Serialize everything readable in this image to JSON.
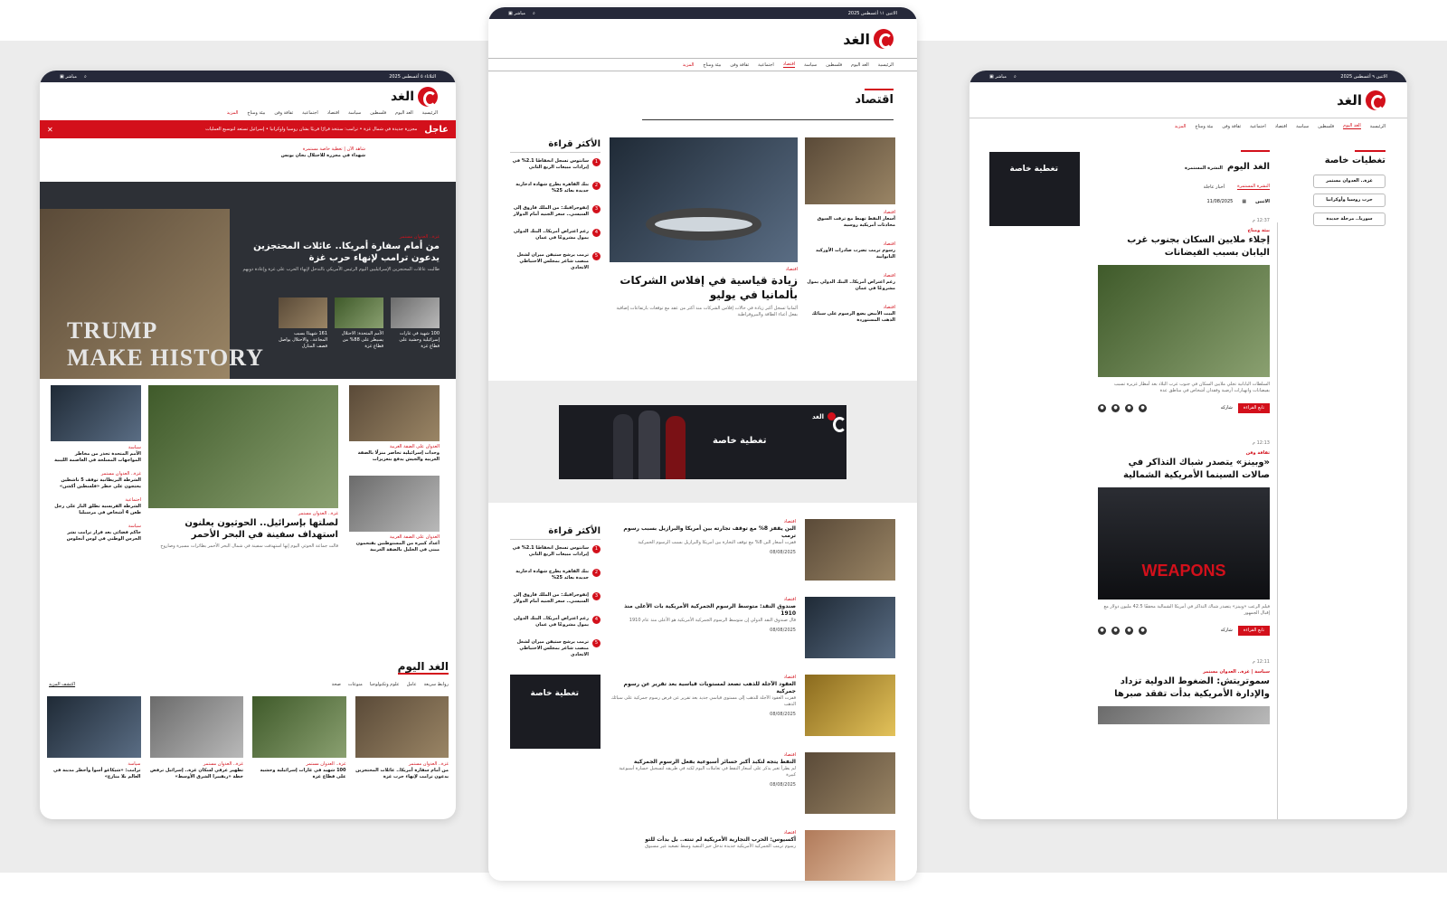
{
  "colors": {
    "accent": "#d3101b",
    "topbar": "#26293a"
  },
  "icons": {
    "search": "search-icon",
    "live": "live-icon",
    "close": "close-icon",
    "share": "share-icon"
  },
  "common": {
    "logo": "الغد",
    "live": "مباشر",
    "nav": [
      "الرئيسية",
      "الغد اليوم",
      "فلسطين",
      "سياسة",
      "اقتصاد",
      "اجتماعية",
      "ثقافة وفن",
      "بيئة ومناخ",
      "المزيد"
    ]
  },
  "left": {
    "date": "الثلاثاء ٥ أغسطس 2025",
    "breaking_label": "عاجل",
    "breaking_text": "مجزرة جديدة في شمال غزة • ترامب: سنتخذ قرارًا قريبًا بشأن روسيا وأوكرانيا • إسرائيل تستعد لتوسيع العمليات",
    "alert_tag": "شاهد الآن | تغطية خاصة مستمرة",
    "alert_text": "شهداء في مجزرة للاحتلال بخان يونس",
    "hero_tag": "غزة.. العدوان مستمر",
    "hero_title": "من أمام سفارة أمريكا.. عائلات المحتجزين يدعون ترامب لإنهاء حرب غزة",
    "hero_sub": "طالبت عائلات المحتجزين الإسرائيليين اليوم الرئيس الأمريكي بالتدخل لإنهاء الحرب على غزة وإعادة ذويهم",
    "hero_thumbs": [
      {
        "text": "100 شهيد في غارات إسرائيلية وحشية على قطاع غزة"
      },
      {
        "text": "الأمم المتحدة: الاحتلال يسيطر على 88% من قطاع غزة"
      },
      {
        "text": "161 شهيدًا بسبب المجاعة.. والاحتلال يواصل قصف المنازل"
      }
    ],
    "right_col": [
      {
        "tag": "العدوان على الضفة الغربية",
        "title": "وحدات إسرائيلية تحاصر منزلًا بالضفة الغربية والجيش يدفع بتعزيزات"
      },
      {
        "tag": "العدوان على الضفة الغربية",
        "title": "أعداد كبيرة من المستوطنين يقتحمون مبنى في الخليل بالضفة الغربية"
      }
    ],
    "center_tag": "غزة.. العدوان مستمر",
    "center_title": "لصلتها بإسرائيل.. الحوثيون يعلنون استهداف سفينة في البحر الأحمر",
    "center_sub": "قالت جماعة الحوثي اليوم إنها استهدفت سفينة في شمال البحر الأحمر بطائرات مسيرة وصاروخ",
    "left_col": [
      {
        "tag": "سياسة",
        "title": "الأمم المتحدة تحذر من مخاطر المواجهات المسلحة في العاصمة الليبية"
      },
      {
        "tag": "غزة.. العدوان مستمر",
        "title": "الشرطة البريطانية توقف 5 ناشطين يحتجون على حظر «فلسطين أكشن»"
      },
      {
        "tag": "اجتماعية",
        "title": "الشرطة الفرنسية تطلق النار على رجل طعن 4 أشخاص في مرسيليا"
      },
      {
        "tag": "سياسة",
        "title": "حاكم فضائي بعد قرار ترامب نشر الحرس الوطني في لوس أنجلوس"
      }
    ],
    "today_title": "الغد اليوم",
    "today_tabs": [
      "روابط سريعة",
      "عامل",
      "علوم وتكنولوجيا",
      "منوعات",
      "صحة"
    ],
    "more": "اكتشف المزيد",
    "today_cards": [
      {
        "tag": "غزة.. العدوان مستمر",
        "title": "من أمام سفارة أمريكا.. عائلات المحتجزين يدعون ترامب لإنهاء حرب غزة"
      },
      {
        "tag": "غزة.. العدوان مستمر",
        "title": "100 شهيد في غارات إسرائيلية وحشية على قطاع غزة"
      },
      {
        "tag": "غزة.. العدوان مستمر",
        "title": "تطهير عرقي لسكان غزة.. إسرائيل ترفض خطة «ريفييرا الشرق الأوسط»"
      },
      {
        "tag": "سياسة",
        "title": "ترامب: «شيكاغو أسوأ وأخطر مدينة في العالم بلا منازع»"
      }
    ]
  },
  "middle": {
    "date": "الاثنين ١١ أغسطس 2025",
    "section": "اقتصاد",
    "most_read": "الأكثر قراءة",
    "most_list": [
      "سانتوس تسجل انخفاضًا 2.1% في إيرادات مبيعات الربع الثاني",
      "بنك القاهرة يطرح شهادة ادخارية جديدة بعائد 25%",
      "إنفوجرافيك: من الملك فاروق إلى السيسي.. سعر الجنيه أمام الدولار",
      "رغم اعتراض أمريكا.. البنك الدولي يمول مشروعًا في عمان",
      "ترمب يرشح ستيفن ميران لشغل منصب شاغر بمجلس الاحتياطي الاتحادي"
    ],
    "feat_tag": "اقتصاد",
    "feat_title": "زيادة قياسية في إفلاس الشركات بألمانيا في يوليو",
    "feat_sub": "ألمانيا تسجل أكبر زيادة في حالات إفلاس الشركات منذ أكثر من عقد مع توقعات بارتفاعات إضافية بفعل أعباء الطاقة والبيروقراطية",
    "side": [
      {
        "tag": "اقتصاد",
        "title": "أسعار النفط تهبط مع ترقب السوق محادثات أمريكية روسية"
      },
      {
        "tag": "اقتصاد",
        "title": "رسوم ترمب تضرب صادرات الأوركيد التايوانية"
      },
      {
        "tag": "اقتصاد",
        "title": "رغم اعتراض أمريكا.. البنك الدولي يمول مشروعًا في عمان"
      },
      {
        "tag": "اقتصاد",
        "title": "البيت الأبيض يضع الرسوم على سبائك الذهب المستوردة"
      }
    ],
    "banner": "تغطية خاصة",
    "list": [
      {
        "tag": "اقتصاد",
        "title": "البن يقفز 8% مع توقف تجارته بين أمريكا والبرازيل بسبب رسوم ترمب",
        "sub": "قفزت أسعار البن 8% مع توقف التجارة بين أمريكا والبرازيل بسبب الرسوم الجمركية",
        "date": "08/08/2025"
      },
      {
        "tag": "اقتصاد",
        "title": "صندوق النقد: متوسط الرسوم الجمركية الأمريكية بات الأعلى منذ 1910",
        "sub": "قال صندوق النقد الدولي إن متوسط الرسوم الجمركية الأمريكية هو الأعلى منذ عام 1910",
        "date": "08/08/2025"
      },
      {
        "tag": "اقتصاد",
        "title": "العقود الآجلة للذهب تصعد لمستويات قياسية بعد تقرير عن رسوم جمركية",
        "sub": "قفزت العقود الآجلة للذهب إلى مستوى قياسي جديد بعد تقرير عن فرض رسوم جمركية على سبائك الذهب",
        "date": "08/08/2025"
      },
      {
        "tag": "اقتصاد",
        "title": "النفط يتجه لتكبد أكبر خسائر أسبوعية بفعل الرسوم الجمركية",
        "sub": "لم يطرأ تغير يذكر على أسعار النفط في تعاملات اليوم لكنه في طريقه لتسجيل خسارة أسبوعية كبيرة",
        "date": "08/08/2025"
      },
      {
        "tag": "اقتصاد",
        "title": "أكسيوس: الحرب التجارية الأمريكية لم تنته.. بل بدأت للتو",
        "sub": "رسوم ترمب الجمركية الأمريكية جديدة تدخل حيز التنفيذ وسط تصعيد غير مسبوق",
        "date": ""
      }
    ]
  },
  "right": {
    "date": "الاثنين ٩ أغسطس 2025",
    "special": "تغطيات خاصة",
    "chips": [
      "غزة.. العدوان مستمر",
      "حرب روسيا وأوكرانيا",
      "سوريا.. مرحلة جديدة"
    ],
    "today_title": "الغد اليوم",
    "today_sub": "النشرة المستمرة",
    "tabs": [
      "النشرة المستمرة",
      "أخبار عاجلة"
    ],
    "day": "الاثنين",
    "date_pick": "11/08/2025",
    "read_more": "تابع القراءة",
    "share": "شاركه",
    "posts": [
      {
        "time": "12:37 م",
        "tag": "بيئة ومناخ",
        "title": "إجلاء ملايين السكان بجنوب غرب اليابان بسبب الفيضانات",
        "sub": "السلطات اليابانية تجلي ملايين السكان في جنوب غرب البلاد بعد أمطار غزيرة تسبب بفيضانات وانهيارات أرضية وفقدان أشخاص في مناطق عدة"
      },
      {
        "time": "12:13 م",
        "tag": "ثقافة وفن",
        "title": "«وبينز» يتصدر شباك التذاكر في صالات السينما الأمريكية الشمالية",
        "sub": "فيلم الرعب «وبينز» يتصدر شباك التذاكر في أمريكا الشمالية محققًا 42.5 مليون دولار مع إقبال الجمهور",
        "poster": "WEAPONS"
      },
      {
        "time": "12:11 م",
        "tag": "سياسة | غزة.. العدوان مستمر",
        "title": "سموتريتش: الضغوط الدولية تزداد والإدارة الأمريكية بدأت تفقد صبرها",
        "sub": ""
      }
    ]
  }
}
